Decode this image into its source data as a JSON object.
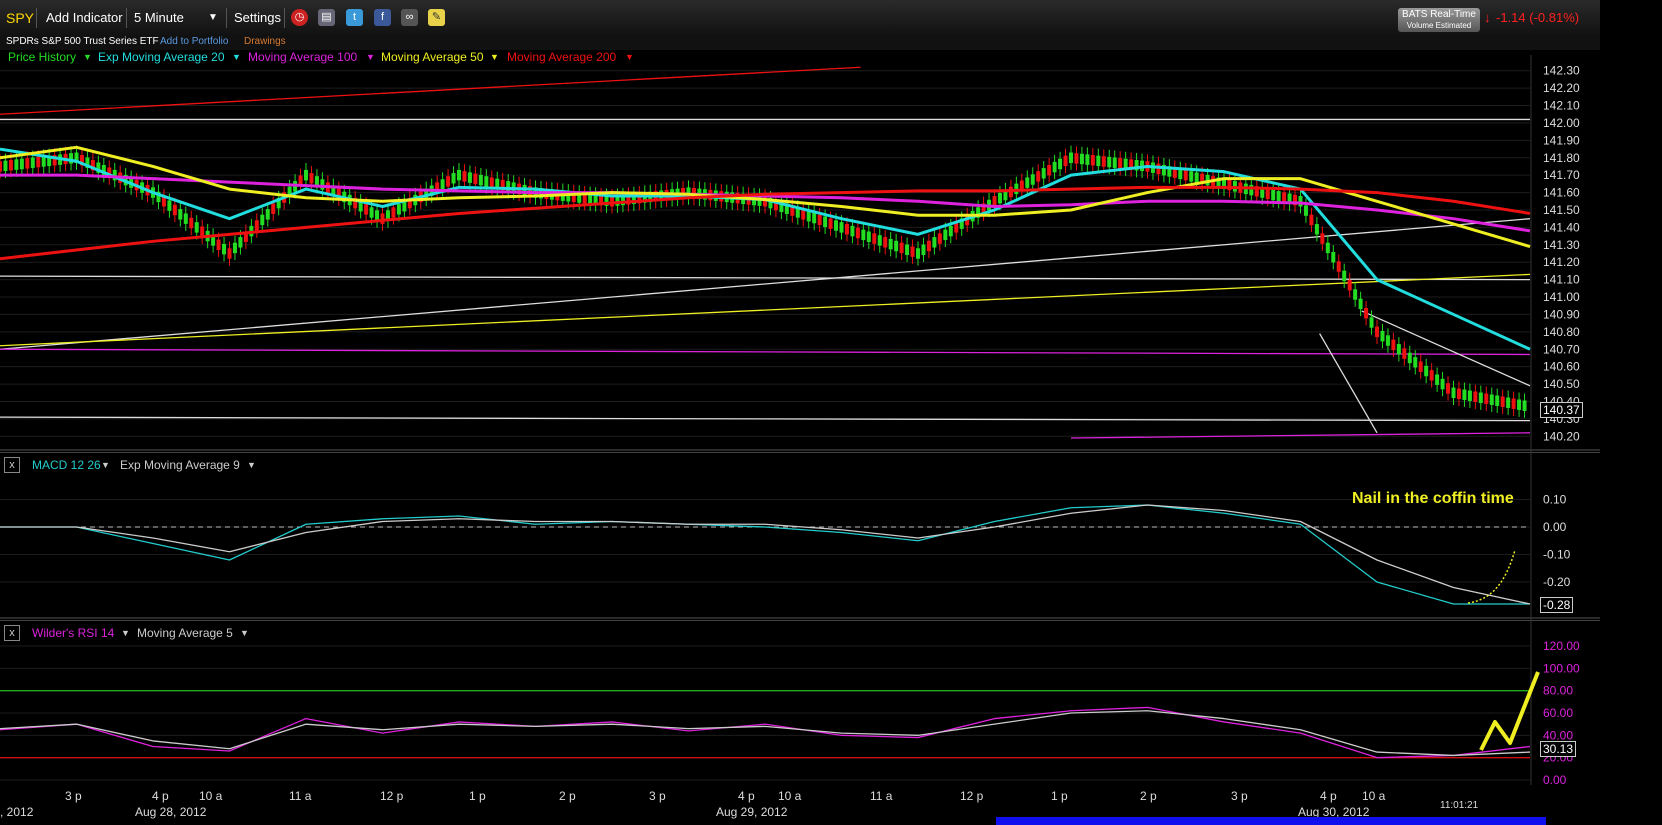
{
  "toolbar": {
    "symbol": "SPY",
    "add_indicator": "Add Indicator",
    "interval": "5 Minute",
    "settings": "Settings",
    "realtime_line1": "BATS Real-Time",
    "realtime_line2": "Volume Estimated",
    "change": "-1.14 (-0.81%)"
  },
  "subheader": {
    "name": "SPDRs S&P 500 Trust Series ETF",
    "add_to_portfolio": "Add to Portfolio",
    "drawings": "Drawings"
  },
  "legend": {
    "price_history": "Price History",
    "ema20": "Exp Moving Average 20",
    "ma100": "Moving Average 100",
    "ma50": "Moving Average 50",
    "ma200": "Moving Average 200"
  },
  "macd_panel": {
    "title": "MACD 12 26",
    "signal": "Exp Moving Average 9",
    "annotation": "Nail in the coffin time",
    "last_value": "-0.28"
  },
  "rsi_panel": {
    "title": "Wilder's RSI 14",
    "signal": "Moving Average 5",
    "last_value": "30.13"
  },
  "price_last_value": "140.37",
  "x_axis": {
    "labels": [
      "3 p",
      "4 p",
      "10 a",
      "11 a",
      "12 p",
      "1 p",
      "2 p",
      "3 p",
      "4 p",
      "10 a",
      "11 a",
      "12 p",
      "1 p",
      "2 p",
      "3 p",
      "4 p",
      "10 a",
      "11:01:21"
    ],
    "dates": [
      ", 2012",
      "Aug 28, 2012",
      "Aug 29, 2012",
      "Aug 30, 2012"
    ]
  },
  "colors": {
    "price_up": "#22dd22",
    "price_down": "#ee1111",
    "ema20": "#22dddd",
    "ma100": "#dd22dd",
    "ma50": "#eeee22",
    "ma200": "#ee1111",
    "macd": "#22cccc",
    "macd_signal": "#cccccc",
    "rsi": "#dd22dd",
    "rsi_signal": "#cccccc",
    "annotation": "#eeee22"
  },
  "chart_data": [
    {
      "type": "line",
      "title": "SPY 5 Minute",
      "ylim": [
        140.15,
        142.35
      ],
      "yticks": [
        "142.30",
        "142.20",
        "142.10",
        "142.00",
        "141.90",
        "141.80",
        "141.70",
        "141.60",
        "141.50",
        "141.40",
        "141.30",
        "141.20",
        "141.10",
        "141.00",
        "140.90",
        "140.80",
        "140.70",
        "140.60",
        "140.50",
        "140.40",
        "140.30",
        "140.20"
      ],
      "x": [
        0,
        20,
        40,
        60,
        80,
        100,
        120,
        140,
        160,
        180,
        200,
        220,
        240,
        260,
        280,
        300,
        320,
        340,
        360,
        380,
        400
      ],
      "series": [
        {
          "name": "Price History",
          "values": [
            141.75,
            141.8,
            141.6,
            141.25,
            141.7,
            141.45,
            141.7,
            141.6,
            141.55,
            141.6,
            141.55,
            141.4,
            141.25,
            141.55,
            141.8,
            141.75,
            141.65,
            141.55,
            140.8,
            140.45,
            140.37
          ]
        },
        {
          "name": "Exp Moving Average 20",
          "values": [
            141.85,
            141.78,
            141.6,
            141.45,
            141.62,
            141.52,
            141.63,
            141.62,
            141.58,
            141.58,
            141.56,
            141.45,
            141.36,
            141.5,
            141.7,
            141.75,
            141.72,
            141.62,
            141.1,
            140.9,
            140.7
          ]
        },
        {
          "name": "Moving Average 100",
          "values": [
            141.7,
            141.7,
            141.68,
            141.66,
            141.64,
            141.62,
            141.61,
            141.6,
            141.6,
            141.59,
            141.58,
            141.57,
            141.55,
            141.52,
            141.53,
            141.55,
            141.55,
            141.54,
            141.5,
            141.45,
            141.38
          ]
        },
        {
          "name": "Moving Average 50",
          "values": [
            141.8,
            141.86,
            141.75,
            141.62,
            141.57,
            141.55,
            141.57,
            141.58,
            141.6,
            141.59,
            141.56,
            141.52,
            141.47,
            141.47,
            141.5,
            141.6,
            141.68,
            141.68,
            141.55,
            141.42,
            141.29
          ]
        },
        {
          "name": "Moving Average 200",
          "values": [
            141.22,
            141.27,
            141.32,
            141.36,
            141.4,
            141.44,
            141.48,
            141.51,
            141.54,
            141.57,
            141.59,
            141.6,
            141.61,
            141.61,
            141.62,
            141.63,
            141.63,
            141.62,
            141.6,
            141.55,
            141.48
          ]
        }
      ]
    },
    {
      "type": "line",
      "title": "MACD 12 26",
      "ylim": [
        -0.32,
        0.2
      ],
      "yticks": [
        "0.10",
        "0.00",
        "-0.10",
        "-0.20"
      ],
      "x": [
        0,
        20,
        40,
        60,
        80,
        100,
        120,
        140,
        160,
        180,
        200,
        220,
        240,
        260,
        280,
        300,
        320,
        340,
        360,
        380,
        400
      ],
      "series": [
        {
          "name": "MACD 12 26",
          "values": [
            0.0,
            0.0,
            -0.06,
            -0.12,
            0.01,
            0.03,
            0.04,
            0.01,
            0.02,
            0.01,
            0.0,
            -0.02,
            -0.05,
            0.02,
            0.07,
            0.08,
            0.05,
            0.01,
            -0.2,
            -0.28,
            -0.28
          ]
        },
        {
          "name": "Exp Moving Average 9",
          "values": [
            0.0,
            0.0,
            -0.04,
            -0.09,
            -0.02,
            0.02,
            0.03,
            0.02,
            0.02,
            0.01,
            0.01,
            -0.01,
            -0.04,
            0.0,
            0.05,
            0.08,
            0.06,
            0.02,
            -0.12,
            -0.22,
            -0.28
          ]
        }
      ]
    },
    {
      "type": "line",
      "title": "Wilder's RSI 14",
      "ylim": [
        0,
        120
      ],
      "yticks": [
        "120.00",
        "100.00",
        "80.00",
        "60.00",
        "40.00",
        "20.00",
        "0.00"
      ],
      "x": [
        0,
        20,
        40,
        60,
        80,
        100,
        120,
        140,
        160,
        180,
        200,
        220,
        240,
        260,
        280,
        300,
        320,
        340,
        360,
        380,
        400
      ],
      "series": [
        {
          "name": "Wilder's RSI 14",
          "values": [
            45,
            50,
            30,
            26,
            55,
            42,
            52,
            48,
            52,
            44,
            50,
            40,
            38,
            55,
            62,
            65,
            52,
            42,
            20,
            22,
            30
          ]
        },
        {
          "name": "Moving Average 5",
          "values": [
            46,
            50,
            35,
            28,
            50,
            45,
            50,
            48,
            50,
            46,
            48,
            42,
            40,
            50,
            60,
            62,
            55,
            45,
            25,
            22,
            25
          ]
        }
      ]
    }
  ]
}
